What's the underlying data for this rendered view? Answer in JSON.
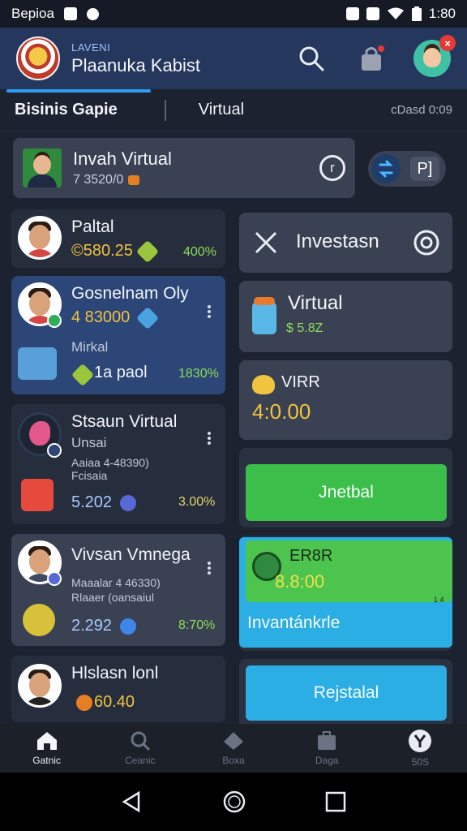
{
  "status_bar": {
    "left_text": "Bepioa",
    "time": "1:80"
  },
  "header": {
    "brand_sub": "LAVENI",
    "brand_title": "Plaanuka Kabist"
  },
  "tabs": {
    "business": "Bisinis Gapie",
    "virtual": "Virtual",
    "meta": "cDasd 0:09"
  },
  "featured": {
    "title": "Invah Virtual",
    "subtitle": "7 3520/0"
  },
  "mini_pill": {
    "right_label": "P]"
  },
  "list": [
    {
      "name": "Paltal",
      "price": "©580.25",
      "pct": "400%"
    },
    {
      "name": "Gosnelnam Oly",
      "price": "4 83000",
      "small": "Mirkal",
      "caption": "Mirkal",
      "action": "1a paol",
      "pct": "1830%"
    },
    {
      "name": "Stsaun Virtual",
      "line1": "Unsai",
      "line2": "Aaiaa 4-48390)",
      "line3": "Fcisaia",
      "price": "5.202",
      "pct": "3.00%"
    },
    {
      "name": "Vivsan Vmnega",
      "line1": "Maaalar 4 46330)",
      "line2": "Rlaaer (oansaiul",
      "price": "2.292",
      "pct": "8:70%"
    },
    {
      "name": "Hlslasn lonl",
      "price": "60.40"
    }
  ],
  "right": {
    "investasn_title": "Investasn",
    "virtual": {
      "title": "Virtual",
      "sub": "$ 5.8Z"
    },
    "virr": {
      "title": "VIRR",
      "amount": "4:0.00"
    },
    "inetbal_label": "Jnetbal",
    "ersr": {
      "title": "ER8R",
      "amount": "8.8:00",
      "footer": "Invantánkrle",
      "tiny": "1 4"
    },
    "rejstalal_label": "Rejstalal"
  },
  "bottom_nav": [
    {
      "label": "Gatnic",
      "icon": "home-icon"
    },
    {
      "label": "Ceanic",
      "icon": "search-icon"
    },
    {
      "label": "Boxa",
      "icon": "tag-icon"
    },
    {
      "label": "Daga",
      "icon": "briefcase-icon"
    },
    {
      "label": "50S",
      "icon": "profile-icon"
    }
  ],
  "colors": {
    "accent": "#2e9df2",
    "green": "#3cbf4a",
    "blue": "#2baee3",
    "header": "#26375d"
  }
}
